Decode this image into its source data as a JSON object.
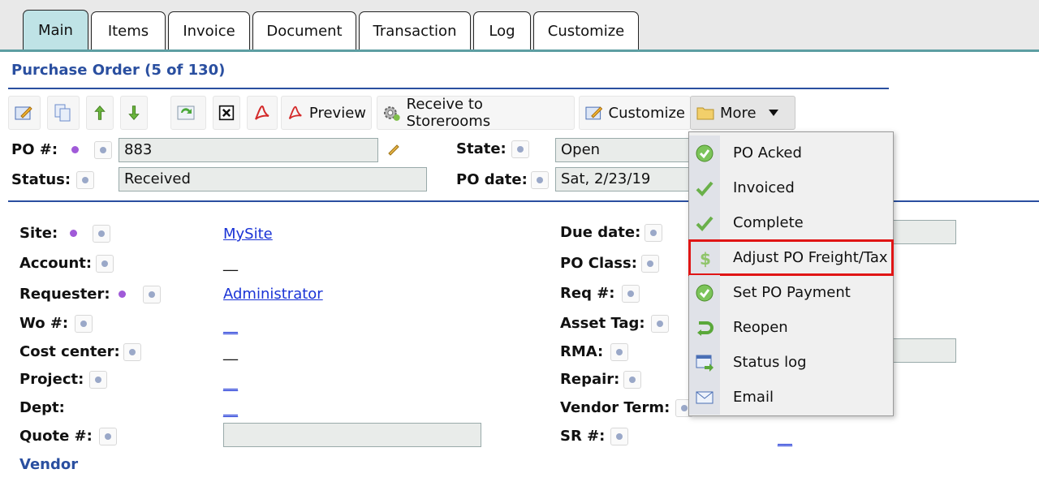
{
  "tabs": [
    "Main",
    "Items",
    "Invoice",
    "Document",
    "Transaction",
    "Log",
    "Customize"
  ],
  "title": "Purchase Order (5 of 130)",
  "toolbar": {
    "preview": "Preview",
    "receive": "Receive to Storerooms",
    "customize": "Customize",
    "more": "More"
  },
  "header": {
    "po_label": "PO #:",
    "po_value": "883",
    "status_label": "Status:",
    "status_value": "Received",
    "state_label": "State:",
    "state_value": "Open",
    "podate_label": "PO date:",
    "podate_value": "Sat, 2/23/19"
  },
  "details": {
    "site_label": "Site:",
    "site_value": "MySite",
    "account_label": "Account:",
    "requester_label": "Requester:",
    "requester_value": "Administrator",
    "wo_label": "Wo #:",
    "cost_label": "Cost center:",
    "project_label": "Project:",
    "dept_label": "Dept:",
    "quote_label": "Quote #:",
    "due_label": "Due date:",
    "poclass_label": "PO Class:",
    "req_label": "Req #:",
    "asset_label": "Asset Tag:",
    "rma_label": "RMA:",
    "repair_label": "Repair:",
    "vendorterm_label": "Vendor Term:",
    "sr_label": "SR #:",
    "dash": "__"
  },
  "section_vendor": "Vendor",
  "menu": {
    "items": [
      "PO Acked",
      "Invoiced",
      "Complete",
      "Adjust PO Freight/Tax",
      "Set PO Payment",
      "Reopen",
      "Status log",
      "Email"
    ],
    "highlighted": "Adjust PO Freight/Tax"
  },
  "colors": {
    "accent": "#2a4fa0",
    "tab_active": "#bfe3e6",
    "highlight": "#e01515"
  }
}
